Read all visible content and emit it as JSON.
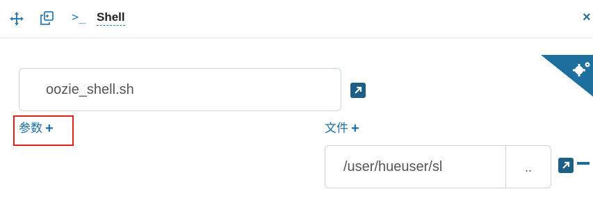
{
  "header": {
    "move_icon": "move-arrows-icon",
    "copy_icon": "clone-icon",
    "terminal_prompt": ">_",
    "title": "Shell",
    "close_label": "×"
  },
  "settings": {
    "icon": "cogs-icon",
    "ribbon_color": "#1f6f9e"
  },
  "script": {
    "value": "oozie_shell.sh",
    "open_icon": "external-link-icon"
  },
  "arguments": {
    "label": "参数",
    "add_icon": "+"
  },
  "files": {
    "label": "文件",
    "add_icon": "+",
    "path_value": "/user/hueuser/sl",
    "browse_label": "..",
    "open_icon": "external-link-icon",
    "remove_icon": "minus-icon"
  },
  "highlight": {
    "target": "arguments",
    "color": "#e0201a"
  },
  "colors": {
    "accent": "#1f6f9e",
    "icon_blue": "#2f7cb0"
  }
}
